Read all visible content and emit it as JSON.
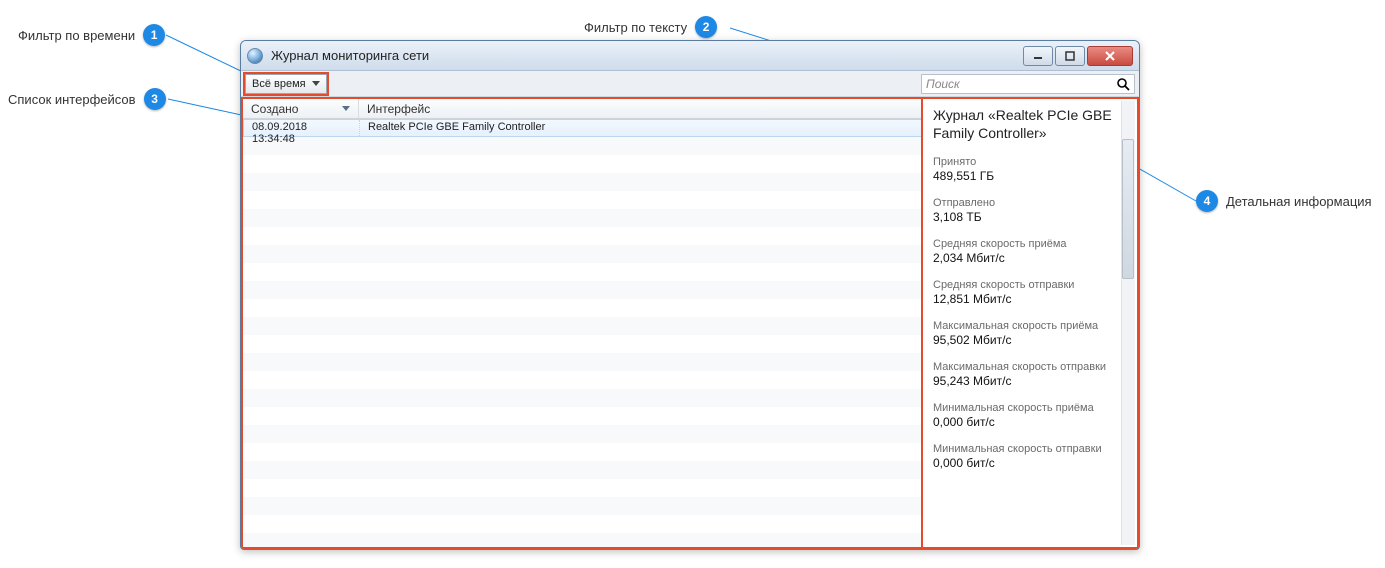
{
  "callouts": {
    "c1": {
      "num": "1",
      "label": "Фильтр по времени"
    },
    "c2": {
      "num": "2",
      "label": "Фильтр по тексту"
    },
    "c3": {
      "num": "3",
      "label": "Список интерфейсов"
    },
    "c4": {
      "num": "4",
      "label": "Детальная информация"
    }
  },
  "window": {
    "title": "Журнал мониторинга сети"
  },
  "toolbar": {
    "time_filter_label": "Всё время",
    "search_placeholder": "Поиск"
  },
  "columns": {
    "created": "Создано",
    "interface": "Интерфейс"
  },
  "rows": [
    {
      "created": "08.09.2018 13:34:48",
      "interface": "Realtek PCIe GBE Family Controller"
    }
  ],
  "details": {
    "title": "Журнал «Realtek PCIe GBE Family Controller»",
    "stats": [
      {
        "label": "Принято",
        "value": "489,551 ГБ"
      },
      {
        "label": "Отправлено",
        "value": "3,108 ТБ"
      },
      {
        "label": "Средняя скорость приёма",
        "value": "2,034 Мбит/с"
      },
      {
        "label": "Средняя скорость отправки",
        "value": "12,851 Мбит/с"
      },
      {
        "label": "Максимальная скорость приёма",
        "value": "95,502 Мбит/с"
      },
      {
        "label": "Максимальная скорость отправки",
        "value": "95,243 Мбит/с"
      },
      {
        "label": "Минимальная скорость приёма",
        "value": "0,000 бит/с"
      },
      {
        "label": "Минимальная скорость отправки",
        "value": "0,000 бит/с"
      }
    ]
  }
}
